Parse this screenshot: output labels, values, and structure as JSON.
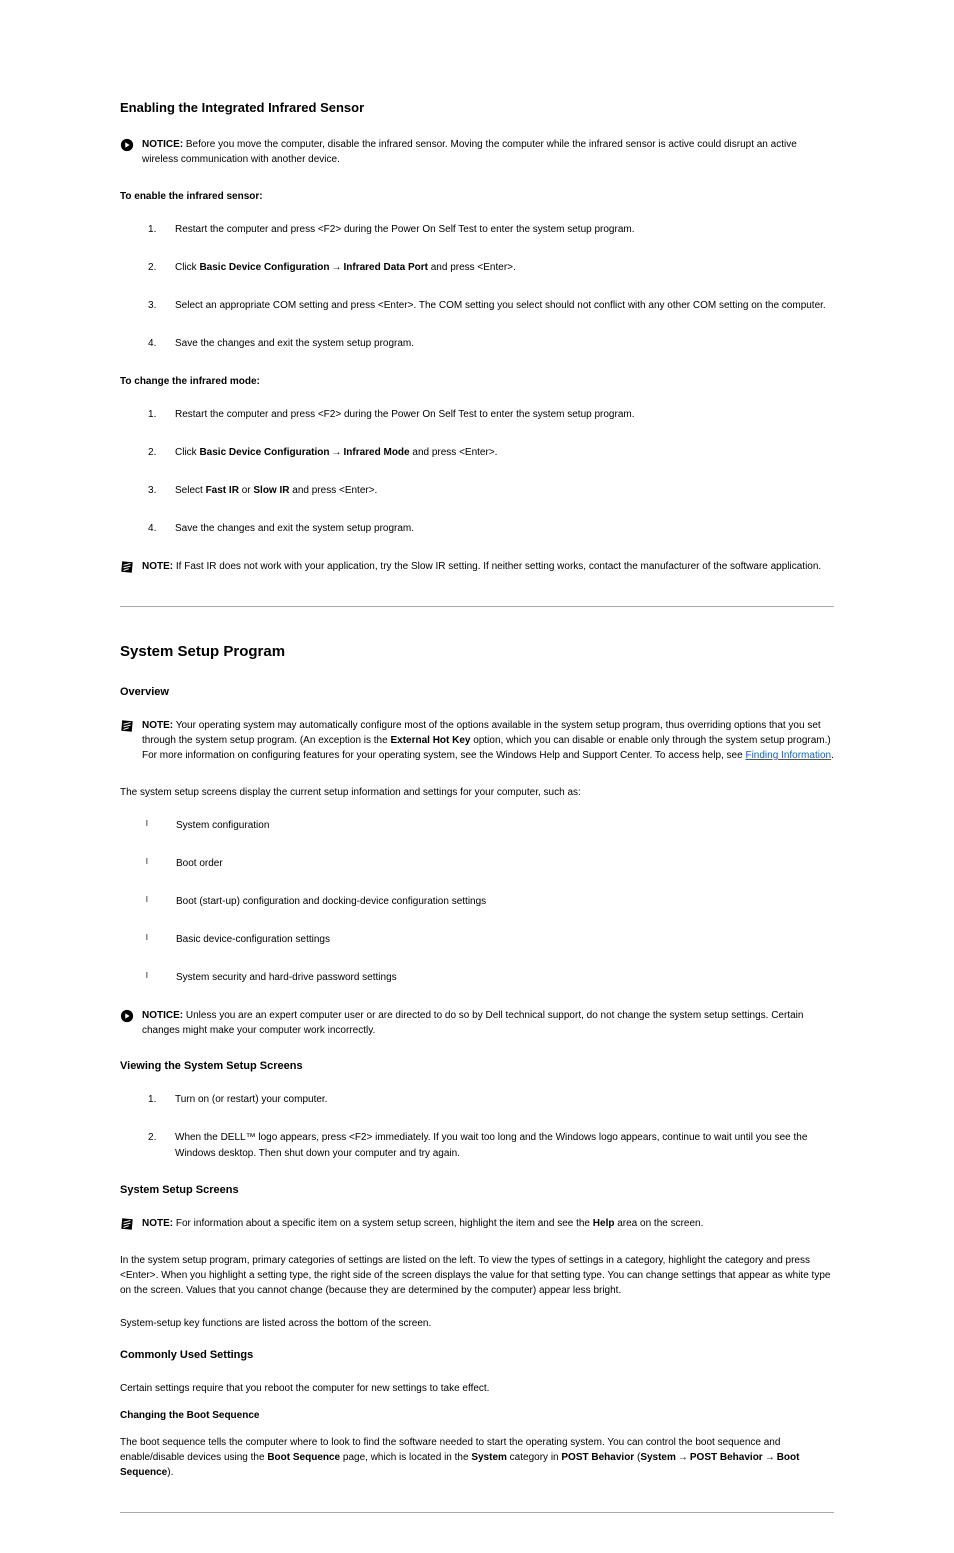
{
  "sec1": {
    "heading": "Enabling the Integrated Infrared Sensor",
    "notice": "NOTICE: Before you move the computer, disable the infrared sensor.  Moving the computer while the infrared sensor is active could disrupt an active wireless communication with another device.",
    "enable_heading": "To enable the infrared sensor:",
    "steps": {
      "s1": "Restart the computer and press <F2> during the Power On Self Test to enter the system setup program.",
      "s2_a": "Click ",
      "s2_b": "Basic Device Configuration",
      "s2_c": "Infrared Data Port",
      "s2_d": " and press <Enter>.",
      "s3": "Select an appropriate COM setting and press <Enter>.  The COM setting you select should not conflict with any other COM setting on the computer.",
      "s4": "Save the changes and exit the system setup program."
    },
    "change_heading": "To change the infrared mode:",
    "csteps": {
      "s1": "Restart the computer and press <F2> during the Power On Self Test to enter the system setup program.",
      "s2_a": "Click ",
      "s2_b": "Basic Device Configuration",
      "s2_c": "Infrared Mode",
      "s2_d": " and press <Enter>.",
      "s3_a": "Select ",
      "s3_b": "Fast IR",
      "s3_c": " or ",
      "s3_d": "Slow IR",
      "s3_e": " and press <Enter>.",
      "s4": "Save the changes and exit the system setup program."
    },
    "note": "NOTE: If Fast IR does not work with your application, try the Slow IR setting. If neither setting works, contact the manufacturer of the software application."
  },
  "sec2": {
    "heading": "System Setup Program",
    "overview_heading": "Overview",
    "note": "NOTE: Your operating system may automatically configure most of the options available in the system setup program, thus overriding options that you set through the system setup program. (An exception is the External Hot Key option, which you can disable or enable only through the system setup program.) For more information on configuring features for your operating system, see the Windows Help and Support Center. To access help, see ",
    "note_link": "Finding Information",
    "note_after": ".",
    "p1": "The system setup screens display the current setup information and settings for your computer, such as:",
    "bullets": [
      "System configuration",
      "Boot order",
      "Boot (start-up) configuration and docking-device configuration settings",
      "Basic device-configuration settings",
      "System security and hard-drive password settings"
    ],
    "notice": "NOTICE: Unless you are an expert computer user or are directed to do so by Dell technical support, do not change the system setup settings. Certain changes might make your computer work incorrectly.",
    "view_heading": "Viewing the System Setup Screens",
    "vsteps": {
      "s1": "Turn on (or restart) your computer.",
      "s2": "When the DELL™ logo appears, press <F2> immediately. If you wait too long and the Windows logo appears, continue to wait until you see the Windows desktop. Then shut down your computer and try again."
    },
    "screens_heading": "System Setup Screens",
    "note2": "NOTE: For information about a specific item on a system setup screen, highlight the item and see the Help area on the screen.",
    "p2": "In the system setup program, primary categories of settings are listed on the left. To view the types of settings in a category, highlight the category and press <Enter>. When you highlight a setting type, the right side of the screen displays the value for that setting type. You can change settings that appear as white type on the screen. Values that you cannot change (because they are determined by the computer) appear less bright.",
    "p3": "System-setup key functions are listed across the bottom of the screen.",
    "common_heading": "Commonly Used Settings",
    "p4": "Certain settings require that you reboot the computer for new settings to take effect.",
    "chboot_heading": "Changing the Boot Sequence",
    "p5_a": "The boot sequence tells the computer where to look to find the software needed to start the operating system. You can control the boot sequence and enable/disable devices using the ",
    "p5_b": "Boot Sequence",
    "p5_c": " page, which is located in the ",
    "p5_d": "System",
    "p5_e": " category in ",
    "p5_f": "POST Behavior",
    "p5_g": " (",
    "p5_h": "System",
    "p5_i": "POST Behavior",
    "p5_j": "Boot Sequence",
    "p5_k": ")."
  },
  "glyphs": {
    "arrow": "→"
  }
}
